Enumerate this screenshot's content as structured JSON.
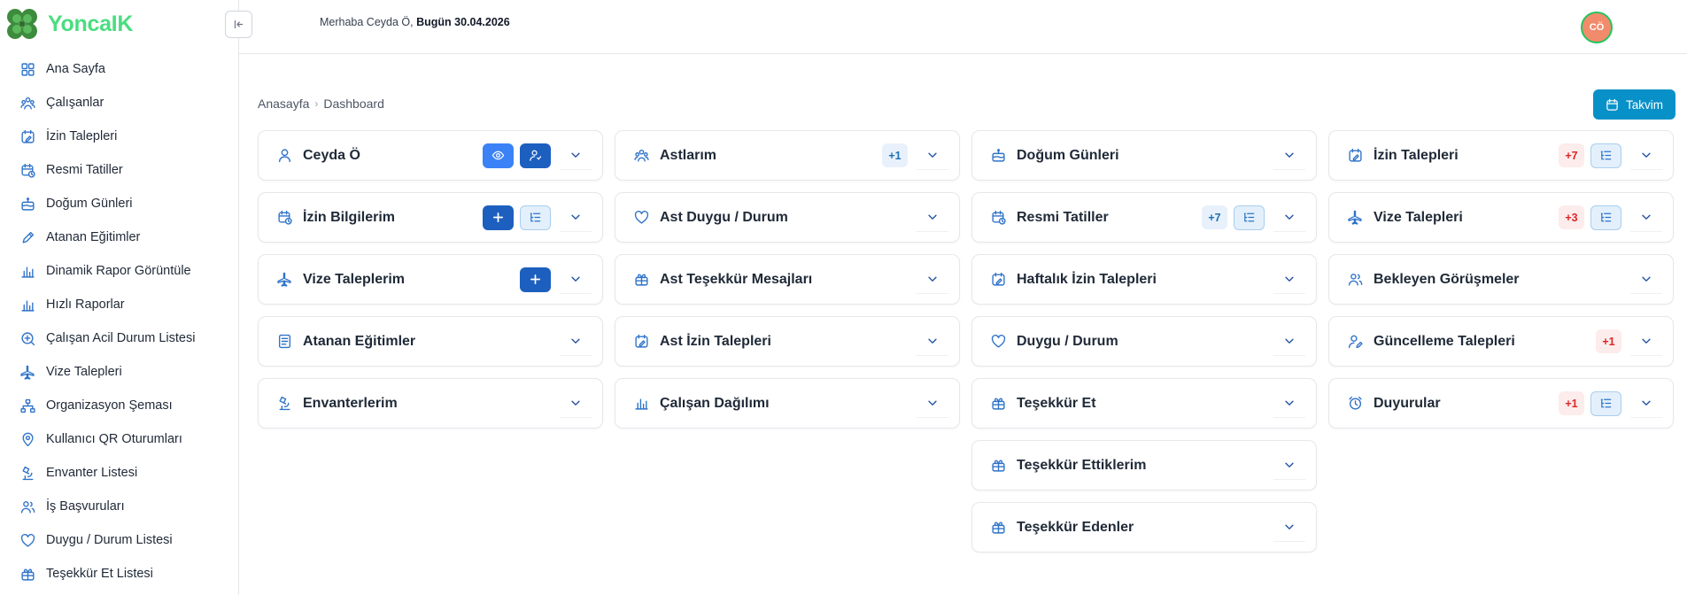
{
  "app": {
    "logo_text": "YoncaIK"
  },
  "header": {
    "greeting": "Merhaba Ceyda Ö,",
    "today": "Bugün 30.04.2026",
    "avatar_initials": "CÖ"
  },
  "sidebar": {
    "items": [
      {
        "label": "Ana Sayfa",
        "icon": "grid-icon"
      },
      {
        "label": "Çalışanlar",
        "icon": "users-icon"
      },
      {
        "label": "İzin Talepleri",
        "icon": "calendar-edit-icon"
      },
      {
        "label": "Resmi Tatiller",
        "icon": "calendar-clock-icon"
      },
      {
        "label": "Doğum Günleri",
        "icon": "cake-icon"
      },
      {
        "label": "Atanan Eğitimler",
        "icon": "pencil-icon"
      },
      {
        "label": "Dinamik Rapor Görüntüle",
        "icon": "bar-chart-icon"
      },
      {
        "label": "Hızlı Raporlar",
        "icon": "bar-chart-icon"
      },
      {
        "label": "Çalışan Acil Durum Listesi",
        "icon": "emergency-icon"
      },
      {
        "label": "Vize Talepleri",
        "icon": "plane-icon"
      },
      {
        "label": "Organizasyon Şeması",
        "icon": "org-chart-icon"
      },
      {
        "label": "Kullanıcı QR Oturumları",
        "icon": "location-pin-icon"
      },
      {
        "label": "Envanter Listesi",
        "icon": "microscope-icon"
      },
      {
        "label": "İş Başvuruları",
        "icon": "user-group-icon"
      },
      {
        "label": "Duygu / Durum Listesi",
        "icon": "heart-icon"
      },
      {
        "label": "Teşekkür Et Listesi",
        "icon": "gift-icon"
      }
    ]
  },
  "breadcrumb": {
    "home": "Anasayfa",
    "current": "Dashboard"
  },
  "calendar_button": {
    "label": "Takvim"
  },
  "columns": [
    [
      {
        "title": "Ceyda Ö",
        "icon": "user-icon",
        "view": true,
        "profile": true
      },
      {
        "title": "İzin Bilgilerim",
        "icon": "calendar-clock-icon",
        "add": true,
        "list": true
      },
      {
        "title": "Vize Taleplerim",
        "icon": "plane-icon",
        "add": true
      },
      {
        "title": "Atanan Eğitimler",
        "icon": "document-icon"
      },
      {
        "title": "Envanterlerim",
        "icon": "microscope-icon"
      }
    ],
    [
      {
        "title": "Astlarım",
        "icon": "users-icon",
        "badge": "+1",
        "badge_color": "blue"
      },
      {
        "title": "Ast Duygu / Durum",
        "icon": "heart-icon"
      },
      {
        "title": "Ast Teşekkür Mesajları",
        "icon": "gift-icon"
      },
      {
        "title": "Ast İzin Talepleri",
        "icon": "calendar-edit-icon"
      },
      {
        "title": "Çalışan Dağılımı",
        "icon": "bar-chart-icon"
      }
    ],
    [
      {
        "title": "Doğum Günleri",
        "icon": "cake-icon"
      },
      {
        "title": "Resmi Tatiller",
        "icon": "calendar-clock-icon",
        "badge": "+7",
        "badge_color": "blue",
        "list": true
      },
      {
        "title": "Haftalık İzin Talepleri",
        "icon": "calendar-edit-icon"
      },
      {
        "title": "Duygu / Durum",
        "icon": "heart-icon"
      },
      {
        "title": "Teşekkür Et",
        "icon": "gift-icon"
      },
      {
        "title": "Teşekkür Ettiklerim",
        "icon": "gift-icon"
      },
      {
        "title": "Teşekkür Edenler",
        "icon": "gift-icon"
      }
    ],
    [
      {
        "title": "İzin Talepleri",
        "icon": "calendar-edit-icon",
        "badge": "+7",
        "badge_color": "red",
        "list": true
      },
      {
        "title": "Vize Talepleri",
        "icon": "plane-icon",
        "badge": "+3",
        "badge_color": "red",
        "list": true
      },
      {
        "title": "Bekleyen Görüşmeler",
        "icon": "user-group-icon"
      },
      {
        "title": "Güncelleme Talepleri",
        "icon": "user-edit-icon",
        "badge": "+1",
        "badge_color": "red"
      },
      {
        "title": "Duyurular",
        "icon": "alarm-icon",
        "badge": "+1",
        "badge_color": "red",
        "list": true
      }
    ]
  ],
  "colors": {
    "accent": "#1d5fbf",
    "calendar_button": "#0891c8",
    "icon": "#2f73c9",
    "logo": "#4ade80"
  }
}
